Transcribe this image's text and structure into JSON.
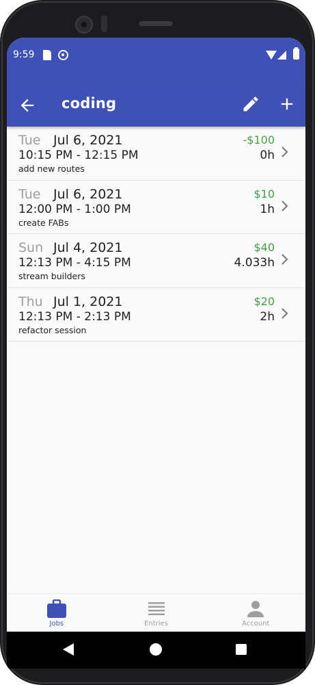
{
  "status_bar": {
    "time": "9:59",
    "icons": [
      "sd-card-icon",
      "sync-icon",
      "wifi-icon",
      "signal-icon",
      "battery-icon"
    ]
  },
  "app_bar": {
    "title": "coding",
    "back_icon": "arrow-back-icon",
    "edit_icon": "pencil-icon",
    "add_icon": "plus-icon"
  },
  "entries": [
    {
      "weekday": "Tue",
      "date": "Jul 6, 2021",
      "time_range": "10:15 PM - 12:15 PM",
      "comment": "add new routes",
      "pay": "-$100",
      "hours": "0h"
    },
    {
      "weekday": "Tue",
      "date": "Jul 6, 2021",
      "time_range": "12:00 PM - 1:00 PM",
      "comment": "create FABs",
      "pay": "$10",
      "hours": "1h"
    },
    {
      "weekday": "Sun",
      "date": "Jul 4, 2021",
      "time_range": "12:13 PM - 4:15 PM",
      "comment": "stream builders",
      "pay": "$40",
      "hours": "4.033h"
    },
    {
      "weekday": "Thu",
      "date": "Jul 1, 2021",
      "time_range": "12:13 PM - 2:13 PM",
      "comment": "refactor session",
      "pay": "$20",
      "hours": "2h"
    }
  ],
  "bottom_nav": {
    "tabs": [
      {
        "label": "Jobs",
        "icon": "briefcase-icon",
        "active": true
      },
      {
        "label": "Entries",
        "icon": "list-icon",
        "active": false
      },
      {
        "label": "Account",
        "icon": "person-icon",
        "active": false
      }
    ]
  },
  "colors": {
    "primary": "#3f51b5",
    "pay_positive": "#43a047",
    "weekday_grey": "#9e9e9e",
    "inactive_nav": "#9e9e9e"
  }
}
